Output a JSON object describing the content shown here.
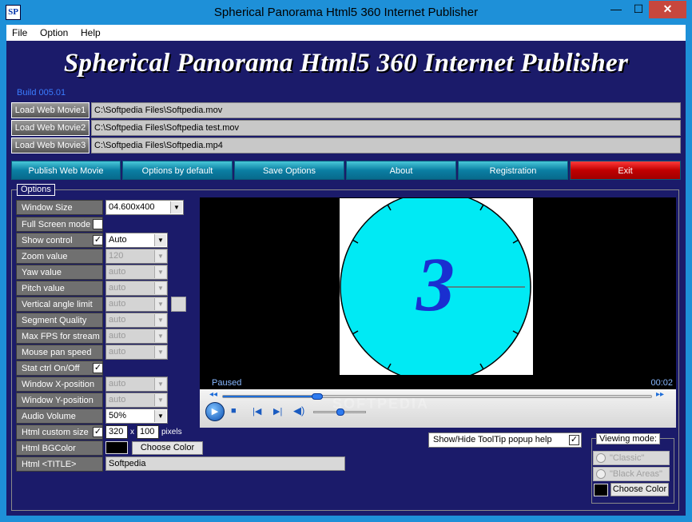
{
  "window": {
    "icon_text": "SP",
    "title": "Spherical Panorama Html5 360 Internet Publisher",
    "min_glyph": "—",
    "max_glyph": "☐",
    "close_glyph": "✕"
  },
  "menu": [
    "File",
    "Option",
    "Help"
  ],
  "banner": {
    "title": "Spherical Panorama Html5 360 Internet Publisher",
    "build": "Build 005.01"
  },
  "load_rows": [
    {
      "button": "Load Web Movie1",
      "path": "C:\\Softpedia Files\\Softpedia.mov"
    },
    {
      "button": "Load Web Movie2",
      "path": "C:\\Softpedia Files\\Softpedia test.mov"
    },
    {
      "button": "Load Web Movie3",
      "path": "C:\\Softpedia Files\\Softpedia.mp4"
    }
  ],
  "actions": {
    "publish": "Publish Web Movie",
    "defaults": "Options by default",
    "save": "Save Options",
    "about": "About",
    "registration": "Registration",
    "exit": "Exit"
  },
  "options": {
    "legend": "Options",
    "window_size": {
      "label": "Window Size",
      "value": "04.600x400"
    },
    "full_screen": {
      "label": "Full Screen mode",
      "checked": false
    },
    "show_control": {
      "label": "Show control",
      "checked": true,
      "value": "Auto"
    },
    "zoom": {
      "label": "Zoom value",
      "value": "120"
    },
    "yaw": {
      "label": "Yaw value",
      "value": "auto"
    },
    "pitch": {
      "label": "Pitch value",
      "value": "auto"
    },
    "vertical_limit": {
      "label": "Vertical angle limit",
      "value": "auto"
    },
    "segment_quality": {
      "label": "Segment Quality",
      "value": "auto"
    },
    "max_fps": {
      "label": "Max FPS for stream",
      "value": "auto"
    },
    "mouse_pan": {
      "label": "Mouse pan speed",
      "value": "auto"
    },
    "stat_ctrl": {
      "label": "Stat ctrl On/Off",
      "checked": true
    },
    "window_x": {
      "label": "Window X-position",
      "value": "auto"
    },
    "window_y": {
      "label": "Window Y-position",
      "value": "auto"
    },
    "audio_volume": {
      "label": "Audio Volume",
      "value": "50%"
    },
    "html_custom_size": {
      "label": "Html custom size",
      "checked": true,
      "width": "320",
      "x": "x",
      "height": "100",
      "unit": "pixels"
    },
    "html_bgcolor": {
      "label": "Html BGColor",
      "button": "Choose Color",
      "color": "#000000"
    },
    "html_title": {
      "label": "Html <TITLE>",
      "value": "Softpedia"
    }
  },
  "player": {
    "status": "Paused",
    "time": "00:02",
    "clock_digit": "3",
    "progress": 0.22,
    "volume": 0.5,
    "watermark": "SOFTPEDIA"
  },
  "tooltip_toggle": {
    "label": "Show/Hide ToolTip popup help",
    "checked": true
  },
  "viewing_mode": {
    "legend": "Viewing mode:",
    "classic": "\"Classic\"",
    "black_areas": "\"Black Areas\"",
    "button": "Choose Color"
  },
  "colors": {
    "banner_bg": "#1b1b6a",
    "teal_button": "#0b7fa3",
    "exit_button": "#c00000",
    "clock_face": "#00e8f0",
    "digit": "#1030d0"
  }
}
